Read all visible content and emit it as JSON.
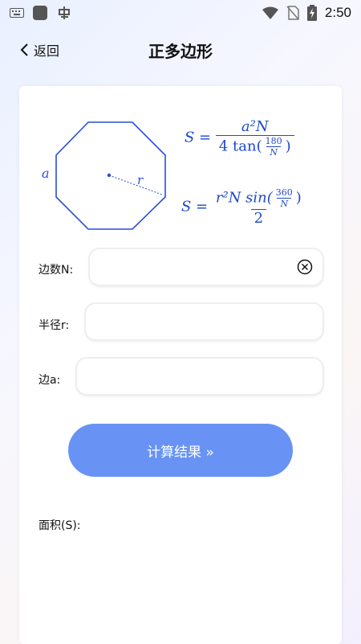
{
  "status_bar": {
    "time": "2:50",
    "left_icons": [
      "keyboard-icon",
      "square-app-icon",
      "app-logo-icon"
    ],
    "right_icons": [
      "wifi-icon",
      "no-signal-icon",
      "battery-charging-icon"
    ]
  },
  "header": {
    "back_label": "返回",
    "title": "正多边形"
  },
  "figure": {
    "side_label": "a",
    "radius_label": "r",
    "stroke_color": "#2a4ddb"
  },
  "formulas": {
    "f1": {
      "lhs": "S =",
      "numerator": "a²N",
      "denominator_prefix": "4 tan(",
      "inner_numerator": "180",
      "inner_denominator": "N",
      "denominator_suffix": ")"
    },
    "f2": {
      "lhs": "S =",
      "numerator_prefix": "r²N sin(",
      "inner_numerator": "360",
      "inner_denominator": "N",
      "numerator_suffix": ")",
      "denominator": "2"
    }
  },
  "form": {
    "sides_label": "边数N:",
    "sides_value": "",
    "radius_label": "半径r:",
    "radius_value": "",
    "edge_label": "边a:",
    "edge_value": ""
  },
  "actions": {
    "calculate_label": "计算结果 »",
    "button_color": "#6893f4"
  },
  "result": {
    "area_label": "面积(S):"
  }
}
